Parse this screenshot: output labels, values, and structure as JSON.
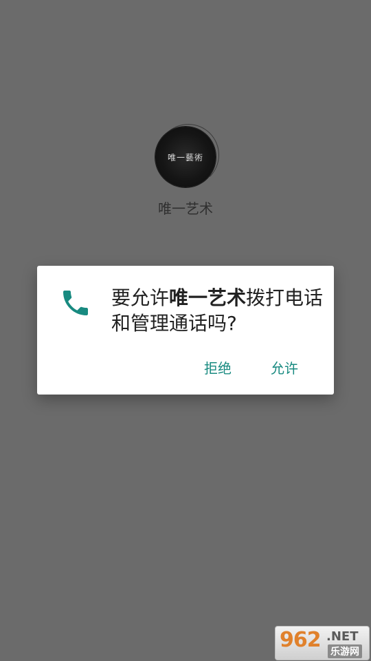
{
  "app": {
    "logo_text": "唯一藝術",
    "name": "唯一艺术"
  },
  "dialog": {
    "message_prefix": "要允许",
    "message_app": "唯一艺术",
    "message_suffix": "拨打电话和管理通话吗?",
    "deny_label": "拒绝",
    "allow_label": "允许",
    "icon": "phone-icon",
    "accent_color": "#188a80"
  },
  "watermark": {
    "number": "962",
    "suffix": ".NET",
    "subtitle": "乐游网"
  }
}
